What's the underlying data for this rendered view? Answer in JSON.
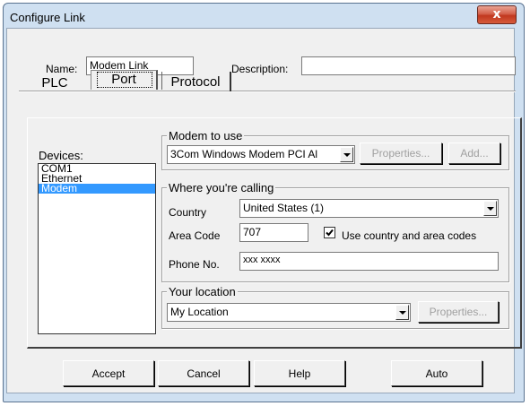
{
  "window": {
    "title": "Configure Link",
    "close_glyph": "x"
  },
  "header": {
    "name_label": "Name:",
    "name_value": "Modem Link",
    "description_label": "Description:",
    "description_value": ""
  },
  "tabs": [
    {
      "label": "PLC"
    },
    {
      "label": "Port"
    },
    {
      "label": "Protocol"
    }
  ],
  "devices": {
    "label": "Devices:",
    "items": [
      "COM1",
      "Ethernet",
      "Modem"
    ],
    "selected": "Modem"
  },
  "modem_group": {
    "title": "Modem to use",
    "modem_value": "3Com Windows Modem PCI Al",
    "properties_label": "Properties...",
    "add_label": "Add..."
  },
  "calling_group": {
    "title": "Where you're calling",
    "country_label": "Country",
    "country_value": "United States (1)",
    "area_code_label": "Area Code",
    "area_code_value": "707",
    "use_codes_label": "Use country and area codes",
    "use_codes_checked": true,
    "phone_label": "Phone No.",
    "phone_value": "xxx xxxx"
  },
  "location_group": {
    "title": "Your location",
    "location_value": "My Location",
    "properties_label": "Properties..."
  },
  "footer": {
    "accept_label": "Accept",
    "cancel_label": "Cancel",
    "help_label": "Help",
    "auto_label": "Auto"
  },
  "colors": {
    "frame": "#cfe0f1",
    "close_button": "#c1381f",
    "selection": "#3399ff",
    "dialog_bg": "#f0f0f0"
  },
  "icons": {
    "close": "close-icon",
    "dropdown": "chevron-down-icon",
    "checkmark": "checkmark-icon"
  }
}
